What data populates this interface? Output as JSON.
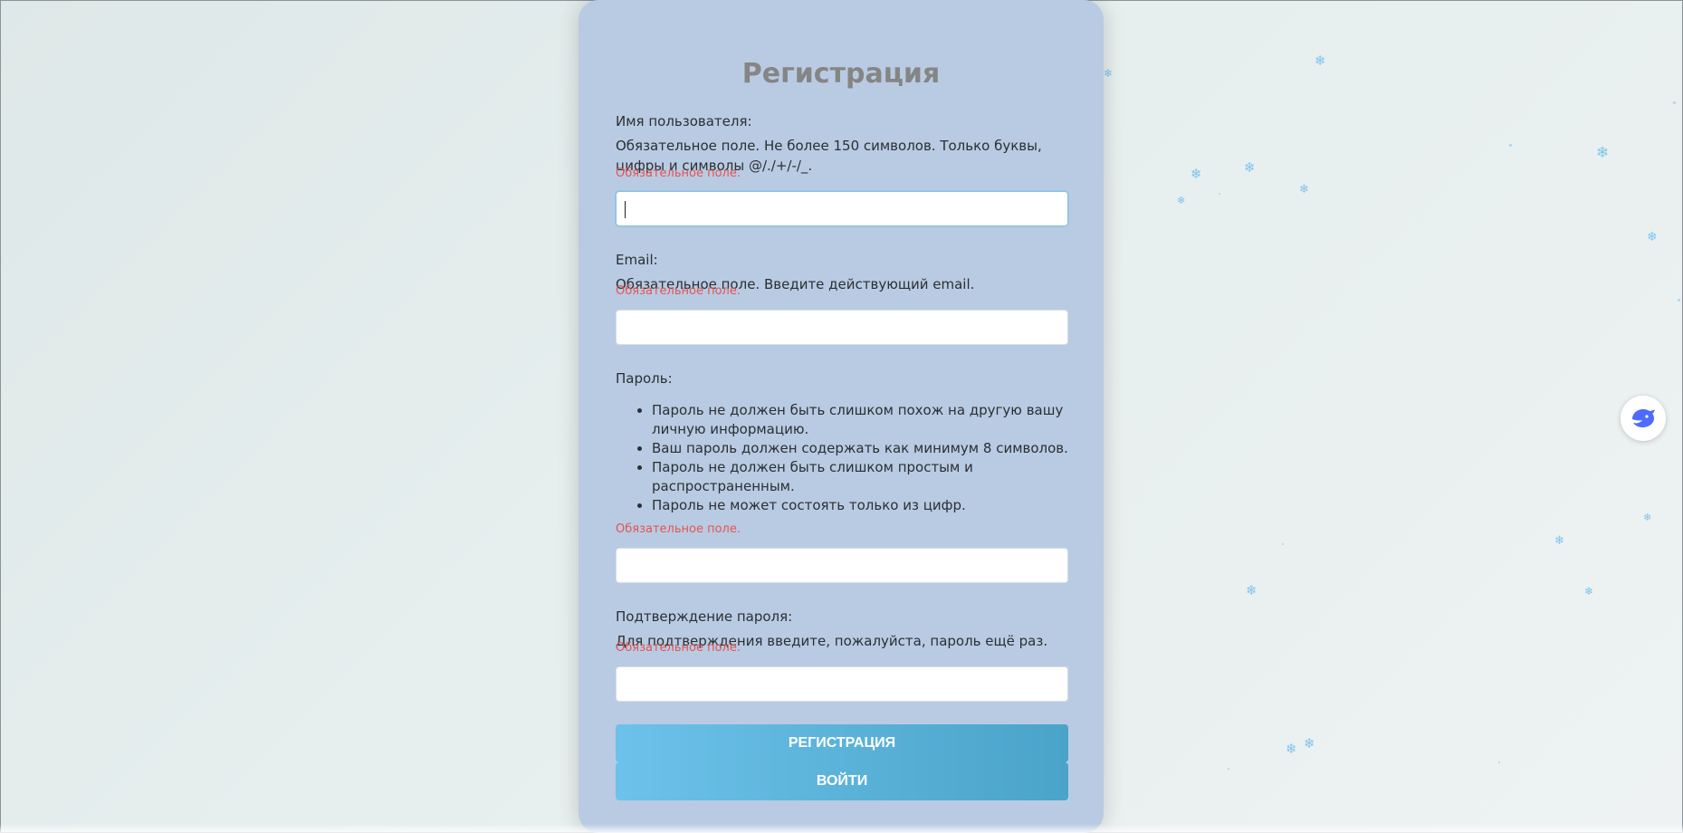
{
  "form": {
    "title": "Регистрация",
    "username": {
      "label": "Имя пользователя:",
      "help": "Обязательное поле. Не более 150 символов. Только буквы, цифры и символы @/./+/-/_.",
      "error": "Обязательное поле.",
      "value": ""
    },
    "email": {
      "label": "Email:",
      "help": "Обязательное поле. Введите действующий email.",
      "error": "Обязательное поле.",
      "value": ""
    },
    "password": {
      "label": "Пароль:",
      "rules": [
        "Пароль не должен быть слишком похож на другую вашу личную информацию.",
        "Ваш пароль должен содержать как минимум 8 символов.",
        "Пароль не должен быть слишком простым и распространенным.",
        "Пароль не может состоять только из цифр."
      ],
      "error": "Обязательное поле.",
      "value": ""
    },
    "password_confirm": {
      "label": "Подтверждение пароля:",
      "help": "Для подтверждения введите, пожалуйста, пароль ещё раз.",
      "error": "Обязательное поле.",
      "value": ""
    },
    "register_button": "РЕГИСТРАЦИЯ",
    "login_button": "ВОЙТИ"
  },
  "side_widget": {
    "icon": "whale-icon",
    "color": "#4d6bfe"
  },
  "colors": {
    "card_background": "#b9cbe2",
    "title": "#858585",
    "error": "#e05555",
    "button": "#5bb3dc",
    "snowflake": "#7fc4ee"
  }
}
